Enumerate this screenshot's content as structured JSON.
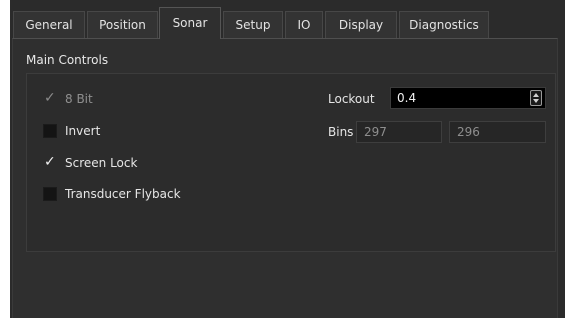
{
  "tabs": [
    {
      "label": "General",
      "active": false
    },
    {
      "label": "Position",
      "active": false
    },
    {
      "label": "Sonar",
      "active": true
    },
    {
      "label": "Setup",
      "active": false
    },
    {
      "label": "IO",
      "active": false
    },
    {
      "label": "Display",
      "active": false
    },
    {
      "label": "Diagnostics",
      "active": false
    }
  ],
  "main_controls": {
    "title": "Main Controls",
    "checkboxes": [
      {
        "label": "8 Bit",
        "checked": true,
        "enabled": false
      },
      {
        "label": "Invert",
        "checked": false,
        "enabled": true
      },
      {
        "label": "Screen Lock",
        "checked": true,
        "enabled": true
      },
      {
        "label": "Transducer Flyback",
        "checked": false,
        "enabled": true
      }
    ],
    "lockout": {
      "label": "Lockout",
      "value": "0.4"
    },
    "bins": {
      "label": "Bins",
      "value_a": "297",
      "value_b": "296"
    }
  },
  "icons": {
    "check": "checkmark-icon",
    "spin_up": "spin-up-arrow-icon",
    "spin_down": "spin-down-arrow-icon"
  },
  "colors": {
    "background": "#2b2b2b",
    "field": "#000000",
    "checkbox": "#141414",
    "text": "#e6e6e6",
    "disabled_text": "#8f8f8f"
  }
}
